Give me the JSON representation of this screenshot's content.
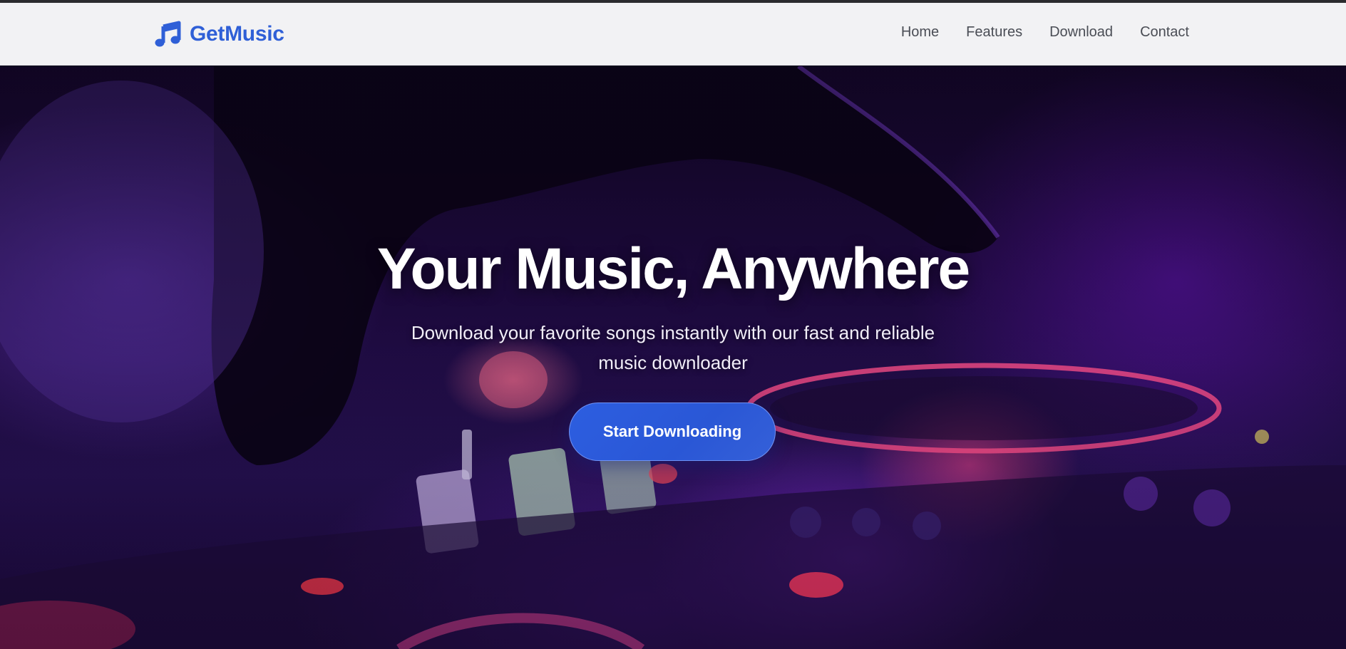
{
  "navbar": {
    "brand": {
      "icon": "music-note-icon",
      "name": "GetMusic",
      "color": "#2f5fd7"
    },
    "links": [
      "Home",
      "Features",
      "Download",
      "Contact"
    ]
  },
  "hero": {
    "background": "dj-mixer-photo",
    "title": "Your Music, Anywhere",
    "subtitle": "Download your favorite songs instantly with our fast and reliable music downloader",
    "cta_label": "Start Downloading",
    "accent_color": "#2d5ee0"
  }
}
